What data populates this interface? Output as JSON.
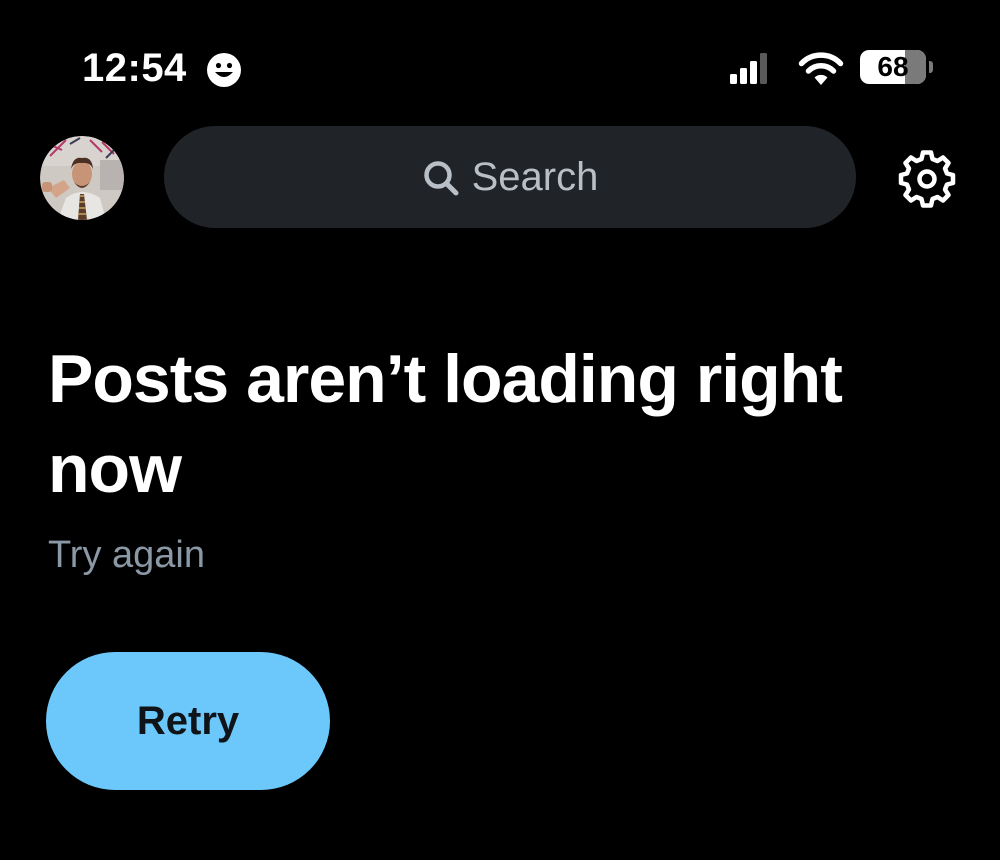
{
  "status_bar": {
    "time": "12:54",
    "battery_level": "68",
    "icons": {
      "focus": "smiley-face-icon",
      "signal": "cellular-signal-icon",
      "wifi": "wifi-icon",
      "battery": "battery-icon"
    }
  },
  "top_bar": {
    "avatar": "profile-avatar",
    "search": {
      "icon": "search-icon",
      "placeholder": "Search"
    },
    "settings_icon": "gear-icon"
  },
  "error": {
    "headline": "Posts aren’t loading right now",
    "subtext": "Try again",
    "retry_label": "Retry"
  },
  "colors": {
    "background": "#000000",
    "search_bg": "#202327",
    "muted_text": "#8b98a5",
    "accent": "#6cc7fb",
    "button_text": "#0f1419"
  }
}
